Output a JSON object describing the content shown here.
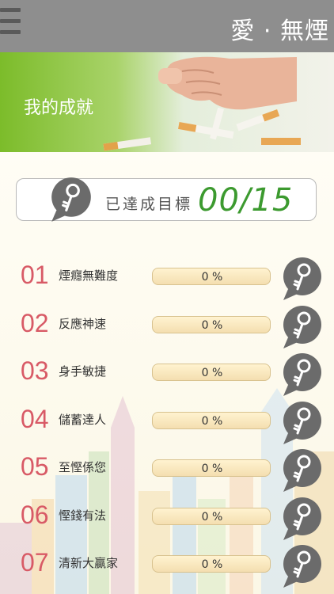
{
  "header": {
    "title": "愛 · 無煙",
    "menu_icon": "hamburger-icon"
  },
  "banner": {
    "title": "我的成就"
  },
  "summary": {
    "label": "已達成目標",
    "count": "00/15",
    "icon": "key-icon"
  },
  "achievements": [
    {
      "num": "01",
      "name": "煙癮無難度",
      "progress": "0 %",
      "value": 0
    },
    {
      "num": "02",
      "name": "反應神速",
      "progress": "0 %",
      "value": 0
    },
    {
      "num": "03",
      "name": "身手敏捷",
      "progress": "0 %",
      "value": 0
    },
    {
      "num": "04",
      "name": "儲蓄達人",
      "progress": "0 %",
      "value": 0
    },
    {
      "num": "05",
      "name": "至慳係您",
      "progress": "0 %",
      "value": 0
    },
    {
      "num": "06",
      "name": "慳錢有法",
      "progress": "0 %",
      "value": 0
    },
    {
      "num": "07",
      "name": "清新大贏家",
      "progress": "0 %",
      "value": 0
    }
  ],
  "colors": {
    "accent_green": "#3c9a2f",
    "number_red": "#d85a66",
    "topbar": "#8e8e8e",
    "banner_green": "#7cbc2a"
  }
}
